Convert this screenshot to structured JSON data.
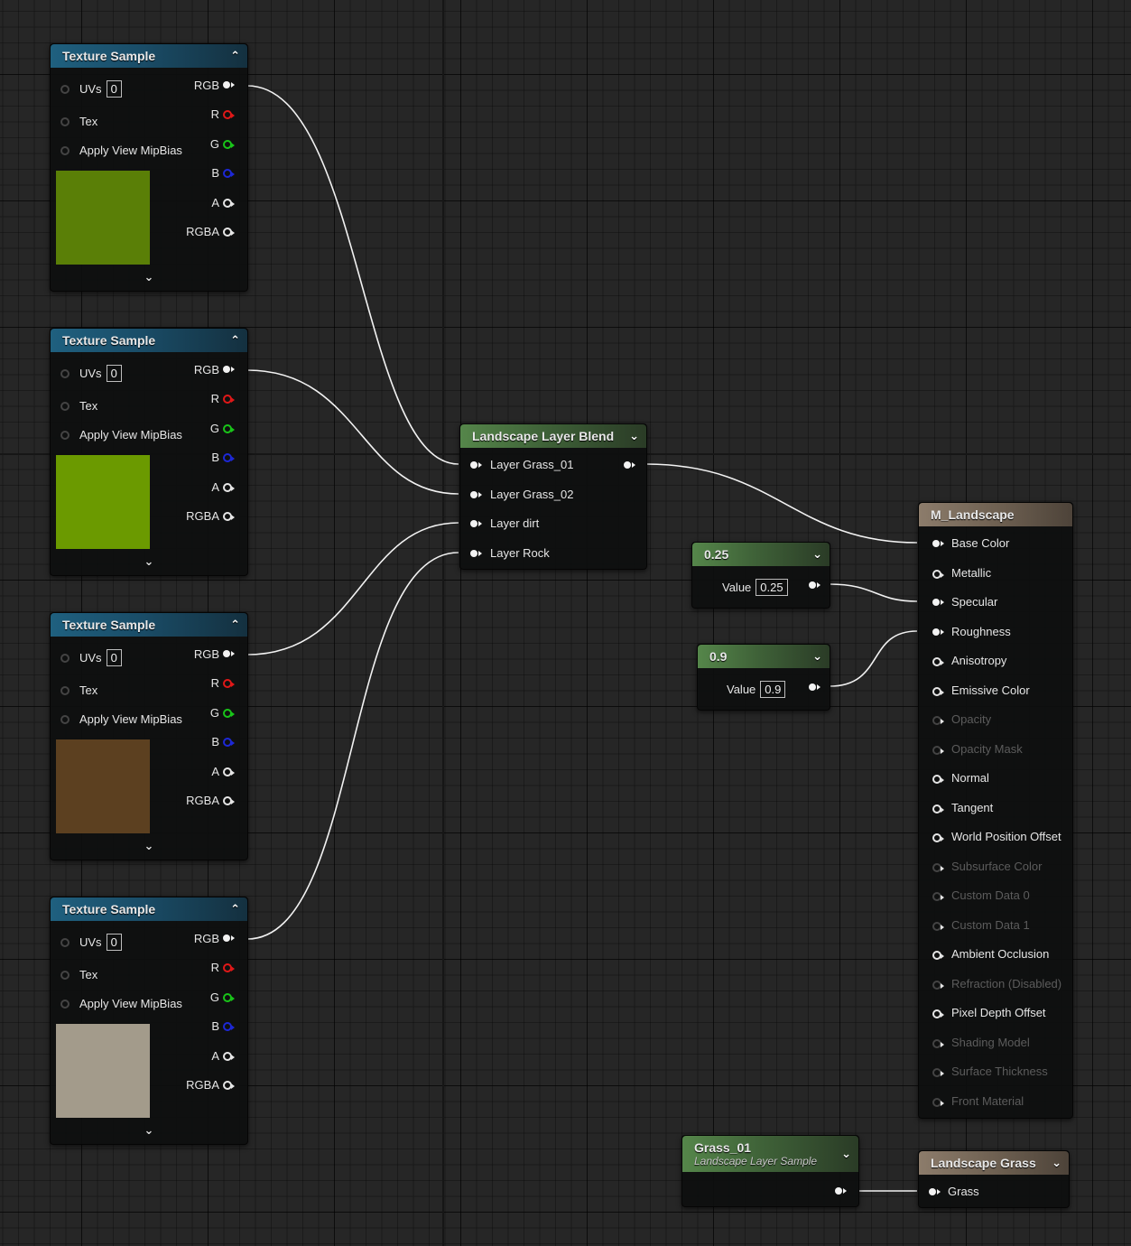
{
  "texture_samples": [
    {
      "title": "Texture Sample",
      "uvs_label": "UVs",
      "uvs_value": "0",
      "tex_label": "Tex",
      "mip_label": "Apply View MipBias",
      "outputs": [
        "RGB",
        "R",
        "G",
        "B",
        "A",
        "RGBA"
      ],
      "swatch_color": "#5a7f07"
    },
    {
      "title": "Texture Sample",
      "uvs_label": "UVs",
      "uvs_value": "0",
      "tex_label": "Tex",
      "mip_label": "Apply View MipBias",
      "outputs": [
        "RGB",
        "R",
        "G",
        "B",
        "A",
        "RGBA"
      ],
      "swatch_color": "#6b9a00"
    },
    {
      "title": "Texture Sample",
      "uvs_label": "UVs",
      "uvs_value": "0",
      "tex_label": "Tex",
      "mip_label": "Apply View MipBias",
      "outputs": [
        "RGB",
        "R",
        "G",
        "B",
        "A",
        "RGBA"
      ],
      "swatch_color": "#5c4020"
    },
    {
      "title": "Texture Sample",
      "uvs_label": "UVs",
      "uvs_value": "0",
      "tex_label": "Tex",
      "mip_label": "Apply View MipBias",
      "outputs": [
        "RGB",
        "R",
        "G",
        "B",
        "A",
        "RGBA"
      ],
      "swatch_color": "#a39b8b"
    }
  ],
  "blend": {
    "title": "Landscape Layer Blend",
    "layers": [
      "Layer Grass_01",
      "Layer Grass_02",
      "Layer dirt",
      "Layer Rock"
    ]
  },
  "const1": {
    "title": "0.25",
    "value_label": "Value",
    "value": "0.25"
  },
  "const2": {
    "title": "0.9",
    "value_label": "Value",
    "value": "0.9"
  },
  "material": {
    "title": "M_Landscape",
    "inputs": [
      {
        "label": "Base Color",
        "state": "connected"
      },
      {
        "label": "Metallic",
        "state": "active"
      },
      {
        "label": "Specular",
        "state": "connected"
      },
      {
        "label": "Roughness",
        "state": "connected"
      },
      {
        "label": "Anisotropy",
        "state": "active"
      },
      {
        "label": "Emissive Color",
        "state": "active"
      },
      {
        "label": "Opacity",
        "state": "disabled"
      },
      {
        "label": "Opacity Mask",
        "state": "disabled"
      },
      {
        "label": "Normal",
        "state": "active"
      },
      {
        "label": "Tangent",
        "state": "active"
      },
      {
        "label": "World Position Offset",
        "state": "active"
      },
      {
        "label": "Subsurface Color",
        "state": "disabled"
      },
      {
        "label": "Custom Data 0",
        "state": "disabled"
      },
      {
        "label": "Custom Data 1",
        "state": "disabled"
      },
      {
        "label": "Ambient Occlusion",
        "state": "active"
      },
      {
        "label": "Refraction (Disabled)",
        "state": "disabled"
      },
      {
        "label": "Pixel Depth Offset",
        "state": "active"
      },
      {
        "label": "Shading Model",
        "state": "disabled"
      },
      {
        "label": "Surface Thickness",
        "state": "disabled"
      },
      {
        "label": "Front Material",
        "state": "disabled"
      }
    ]
  },
  "layer_sample": {
    "title": "Grass_01",
    "subtitle": "Landscape Layer Sample"
  },
  "grass_node": {
    "title": "Landscape Grass",
    "input_label": "Grass"
  }
}
